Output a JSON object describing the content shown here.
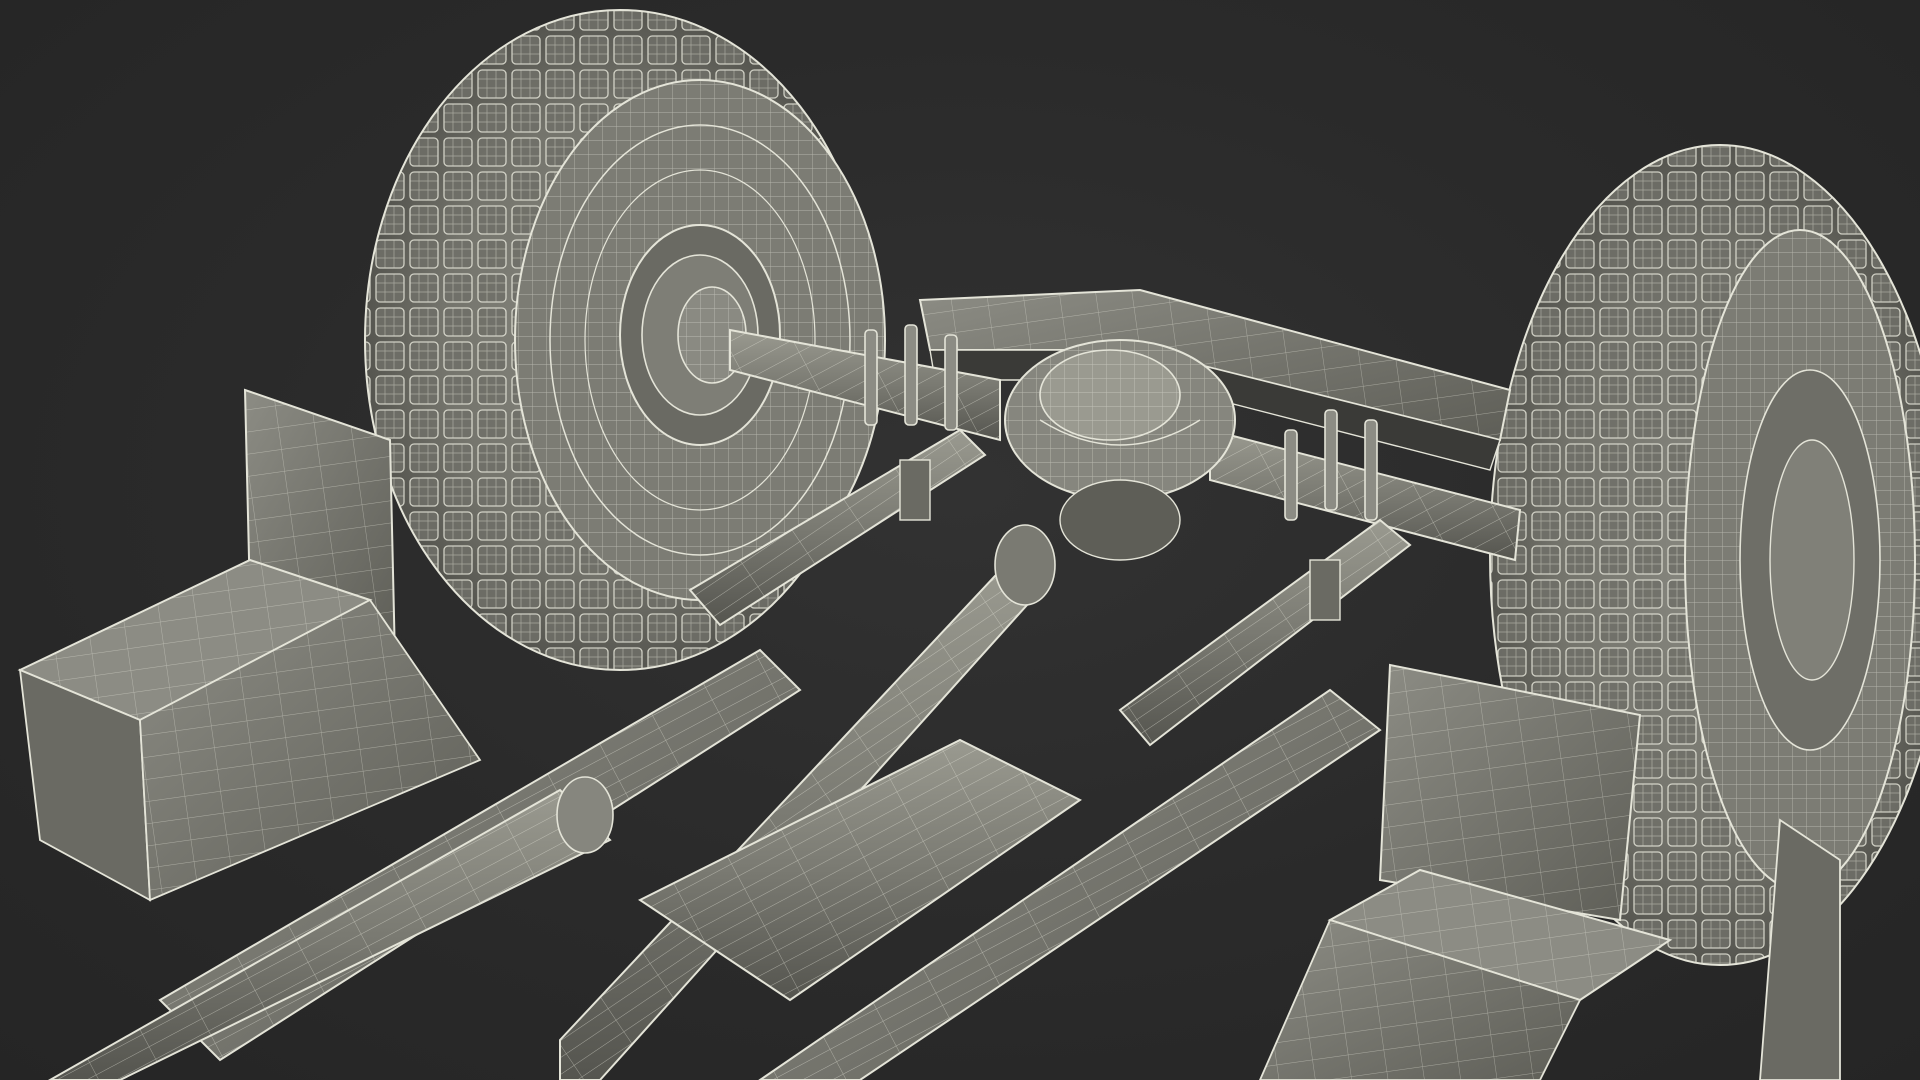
{
  "scene": {
    "subject": "",
    "background_color": "#2a2a2a",
    "model_fill": "#7a7a72",
    "model_fill_dark": "#5e5e57",
    "model_fill_light": "#9a9a90",
    "wire_color": "#e4e4d8",
    "wire_color_soft": "#c9c9bc"
  }
}
